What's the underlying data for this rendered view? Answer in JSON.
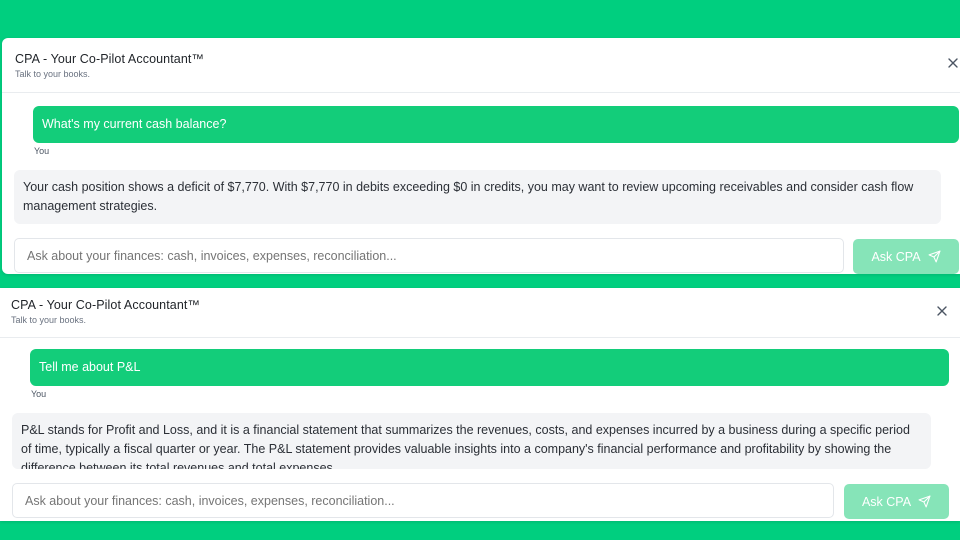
{
  "panels": [
    {
      "title": "CPA - Your Co-Pilot Accountant™",
      "subtitle": "Talk to your books.",
      "user_message": "What's my current cash balance?",
      "user_label": "You",
      "assistant_message": "Your cash position shows a deficit of $7,770. With $7,770 in debits exceeding $0 in credits, you may want to review upcoming receivables and consider cash flow management strategies.",
      "input_placeholder": "Ask about your finances: cash, invoices, expenses, reconciliation...",
      "send_label": "Ask CPA"
    },
    {
      "title": "CPA - Your Co-Pilot Accountant™",
      "subtitle": "Talk to your books.",
      "user_message": "Tell me about P&L",
      "user_label": "You",
      "assistant_message": "P&L stands for Profit and Loss, and it is a financial statement that summarizes the revenues, costs, and expenses incurred by a business during a specific period of time, typically a fiscal quarter or year. The P&L statement provides valuable insights into a company's financial performance and profitability by showing the difference between its total revenues and total expenses.",
      "input_placeholder": "Ask about your finances: cash, invoices, expenses, reconciliation...",
      "send_label": "Ask CPA"
    }
  ],
  "icons": {
    "close": "close-icon",
    "send": "send-icon"
  },
  "colors": {
    "background": "#00cf7f",
    "user_bubble": "#13cd7a",
    "send_button_disabled": "#86e4b8",
    "assistant_bubble": "#f3f4f6"
  }
}
